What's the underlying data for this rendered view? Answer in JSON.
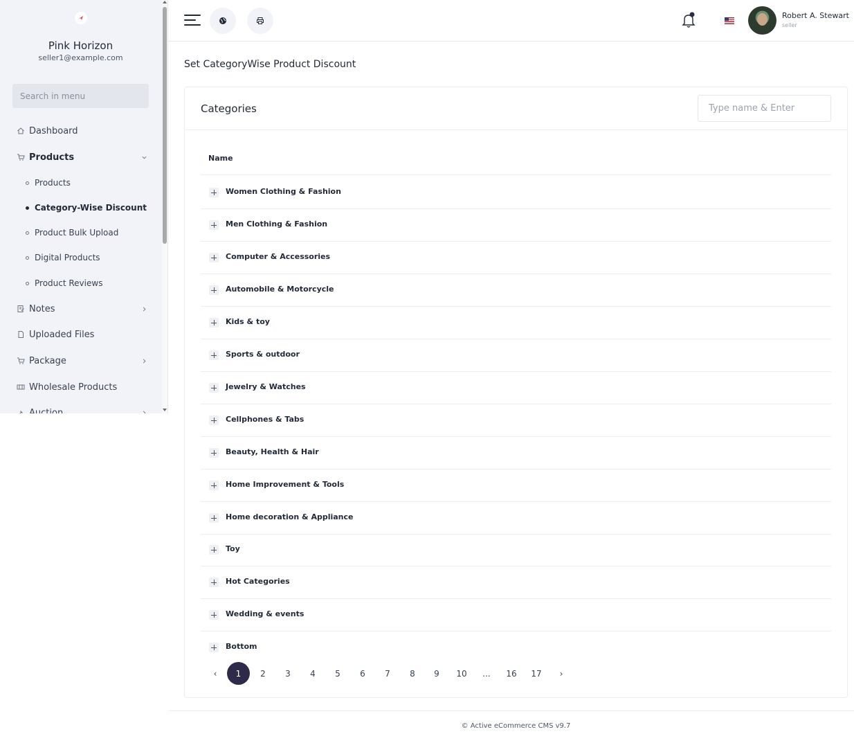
{
  "sidebar": {
    "shop_name": "Pink Horizon",
    "shop_email": "seller1@example.com",
    "search_placeholder": "Search in menu",
    "items": [
      {
        "label": "Dashboard",
        "icon": "home-icon"
      },
      {
        "label": "Products",
        "icon": "cart-icon",
        "expanded": true
      },
      {
        "label": "Notes",
        "icon": "note-icon"
      },
      {
        "label": "Uploaded Files",
        "icon": "file-icon"
      },
      {
        "label": "Package",
        "icon": "cart-icon"
      },
      {
        "label": "Wholesale Products",
        "icon": "wholesale-icon"
      },
      {
        "label": "Auction",
        "icon": "gavel-icon"
      }
    ],
    "sub_items": [
      {
        "label": "Products"
      },
      {
        "label": "Category-Wise Discount",
        "active": true
      },
      {
        "label": "Product Bulk Upload"
      },
      {
        "label": "Digital Products"
      },
      {
        "label": "Product Reviews"
      }
    ]
  },
  "header": {
    "user_name": "Robert A. Stewart",
    "user_role": "seller"
  },
  "main": {
    "page_title": "Set CategoryWise Product Discount",
    "card_title": "Categories",
    "filter_placeholder": "Type name & Enter",
    "column_name": "Name",
    "rows": [
      "Women Clothing & Fashion",
      "Men Clothing & Fashion",
      "Computer & Accessories",
      "Automobile & Motorcycle",
      "Kids & toy",
      "Sports & outdoor",
      "Jewelry & Watches",
      "Cellphones & Tabs",
      "Beauty, Health & Hair",
      "Home Improvement & Tools",
      "Home decoration & Appliance",
      "Toy",
      "Hot Categories",
      "Wedding & events",
      "Bottom"
    ],
    "pagination": {
      "prev": "‹",
      "pages": [
        "1",
        "2",
        "3",
        "4",
        "5",
        "6",
        "7",
        "8",
        "9",
        "10",
        "...",
        "16",
        "17"
      ],
      "next": "›",
      "current": "1"
    }
  },
  "footer": {
    "text": "© Active eCommerce CMS v9.7"
  },
  "colors": {
    "sidebar_bg": "#f2f3f8",
    "active_page": "#2d2a4a"
  }
}
